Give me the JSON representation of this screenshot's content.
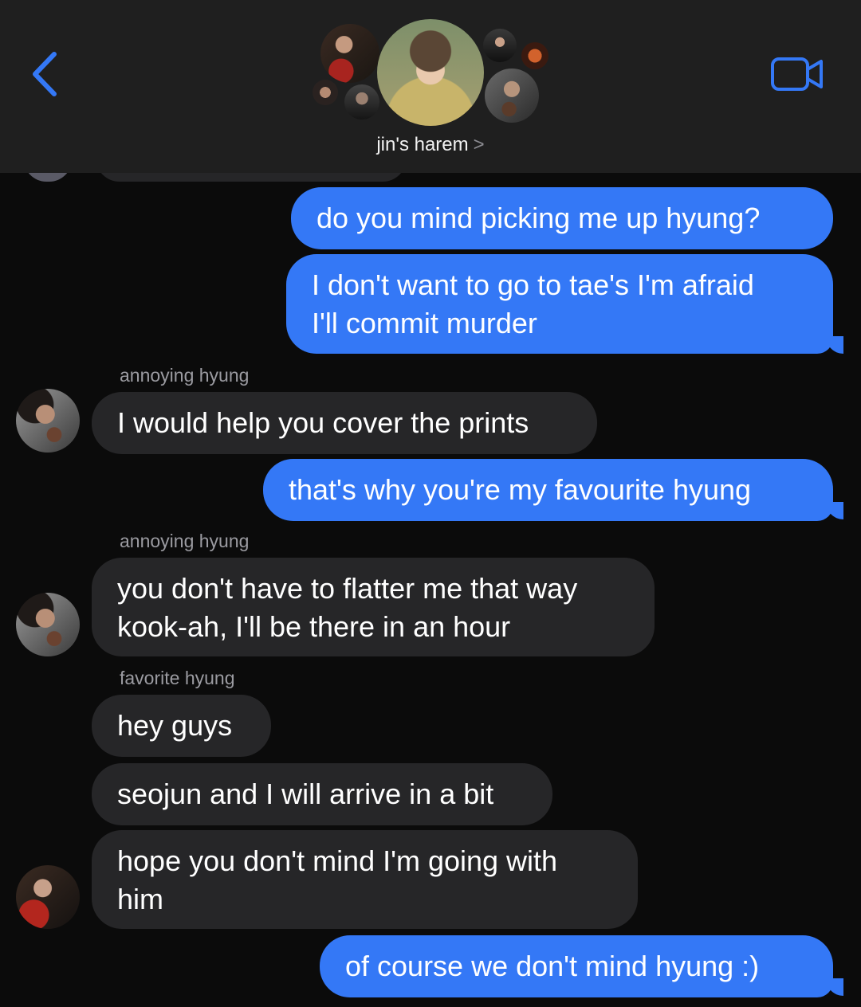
{
  "header": {
    "group_name": "jin's harem",
    "title_chevron": ">",
    "back_icon": "chevron-left-icon",
    "video_icon": "video-camera-icon"
  },
  "colors": {
    "accent": "#3478f6",
    "incoming_bubble": "#262628",
    "background": "#0b0b0b",
    "header_background": "#1f1f1f",
    "sender_name": "#9b9ba1"
  },
  "messages": [
    {
      "direction": "outgoing",
      "lines": [
        "do you mind picking me up hyung?"
      ]
    },
    {
      "direction": "outgoing",
      "lines": [
        "I don't want to go to tae's I'm afraid",
        "I'll commit murder"
      ]
    },
    {
      "direction": "incoming",
      "sender": "annoying hyung",
      "lines": [
        "I would help you cover the prints"
      ]
    },
    {
      "direction": "outgoing",
      "lines": [
        "that's why you're my favourite hyung"
      ]
    },
    {
      "direction": "incoming",
      "sender": "annoying hyung",
      "lines": [
        "you don't have to flatter me that way",
        "kook-ah, I'll be there in an hour"
      ]
    },
    {
      "direction": "incoming",
      "sender": "favorite hyung",
      "lines": [
        "hey guys"
      ]
    },
    {
      "direction": "incoming",
      "lines": [
        "seojun and I will arrive in a bit"
      ]
    },
    {
      "direction": "incoming",
      "lines": [
        "hope you don't mind I'm going with",
        "him"
      ]
    },
    {
      "direction": "outgoing",
      "lines": [
        "of course we don't mind hyung :)"
      ]
    }
  ]
}
